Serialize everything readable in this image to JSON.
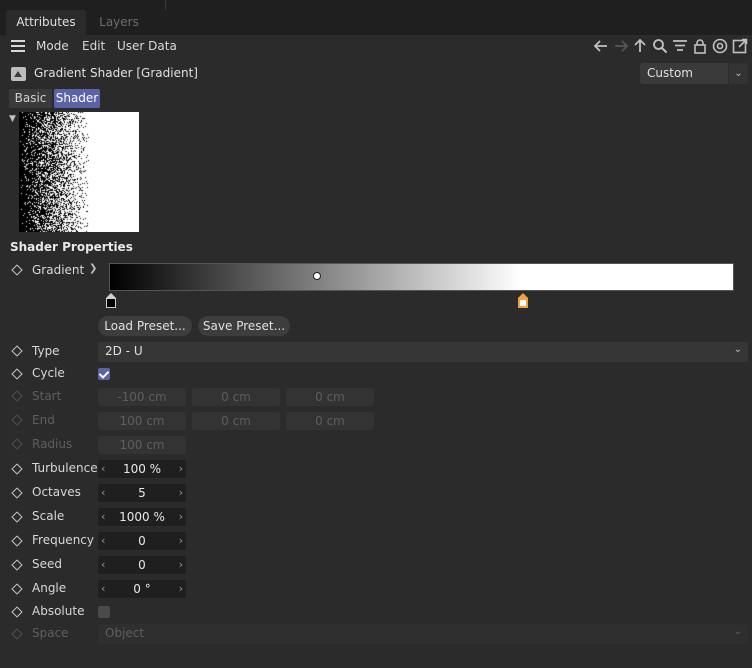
{
  "tabs": [
    {
      "label": "Attributes",
      "active": true
    },
    {
      "label": "Layers",
      "active": false
    }
  ],
  "menu": {
    "items": [
      "Mode",
      "Edit",
      "User Data"
    ],
    "nav_icons": [
      "arrow-left-icon",
      "arrow-right-icon",
      "arrow-up-icon",
      "search-icon",
      "filter-icon",
      "lock-icon",
      "target-icon",
      "new-window-icon"
    ]
  },
  "object": {
    "title": "Gradient Shader [Gradient]",
    "preset": "Custom"
  },
  "subtabs": [
    {
      "label": "Basic",
      "active": false
    },
    {
      "label": "Shader",
      "active": true
    }
  ],
  "section": {
    "title": "Shader Properties"
  },
  "gradient": {
    "label": "Gradient",
    "load_preset": "Load Preset...",
    "save_preset": "Save Preset...",
    "knots": [
      {
        "position": 0.0,
        "color": "#000000"
      },
      {
        "position": 0.66,
        "color": "#ffffff"
      }
    ],
    "interpolation_point": 0.33
  },
  "type": {
    "label": "Type",
    "value": "2D - U"
  },
  "cycle": {
    "label": "Cycle",
    "checked": true
  },
  "start": {
    "label": "Start",
    "x": "-100 cm",
    "y": "0 cm",
    "z": "0 cm"
  },
  "end": {
    "label": "End",
    "x": "100 cm",
    "y": "0 cm",
    "z": "0 cm"
  },
  "radius": {
    "label": "Radius",
    "value": "100 cm"
  },
  "turbulence": {
    "label": "Turbulence",
    "value": "100 %"
  },
  "octaves": {
    "label": "Octaves",
    "value": "5"
  },
  "scale": {
    "label": "Scale",
    "value": "1000 %"
  },
  "frequency": {
    "label": "Frequency",
    "value": "0"
  },
  "seed": {
    "label": "Seed",
    "value": "0"
  },
  "angle": {
    "label": "Angle",
    "value": "0 °"
  },
  "absolute": {
    "label": "Absolute",
    "checked": false
  },
  "space": {
    "label": "Space",
    "value": "Object"
  },
  "colors": {
    "accent": "#5a62a8",
    "knot_selected": "#f0a040"
  }
}
